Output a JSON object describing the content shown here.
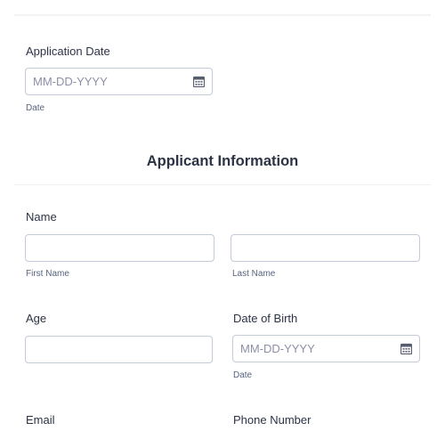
{
  "application_date": {
    "label": "Application Date",
    "placeholder": "MM-DD-YYYY",
    "sublabel": "Date",
    "icon": "calendar-icon"
  },
  "applicant_section": {
    "title": "Applicant Information"
  },
  "name": {
    "label": "Name",
    "first_sublabel": "First Name",
    "last_sublabel": "Last Name"
  },
  "age": {
    "label": "Age"
  },
  "date_of_birth": {
    "label": "Date of Birth",
    "placeholder": "MM-DD-YYYY",
    "sublabel": "Date",
    "icon": "calendar-icon"
  },
  "email": {
    "label": "Email"
  },
  "phone": {
    "label": "Phone Number"
  }
}
